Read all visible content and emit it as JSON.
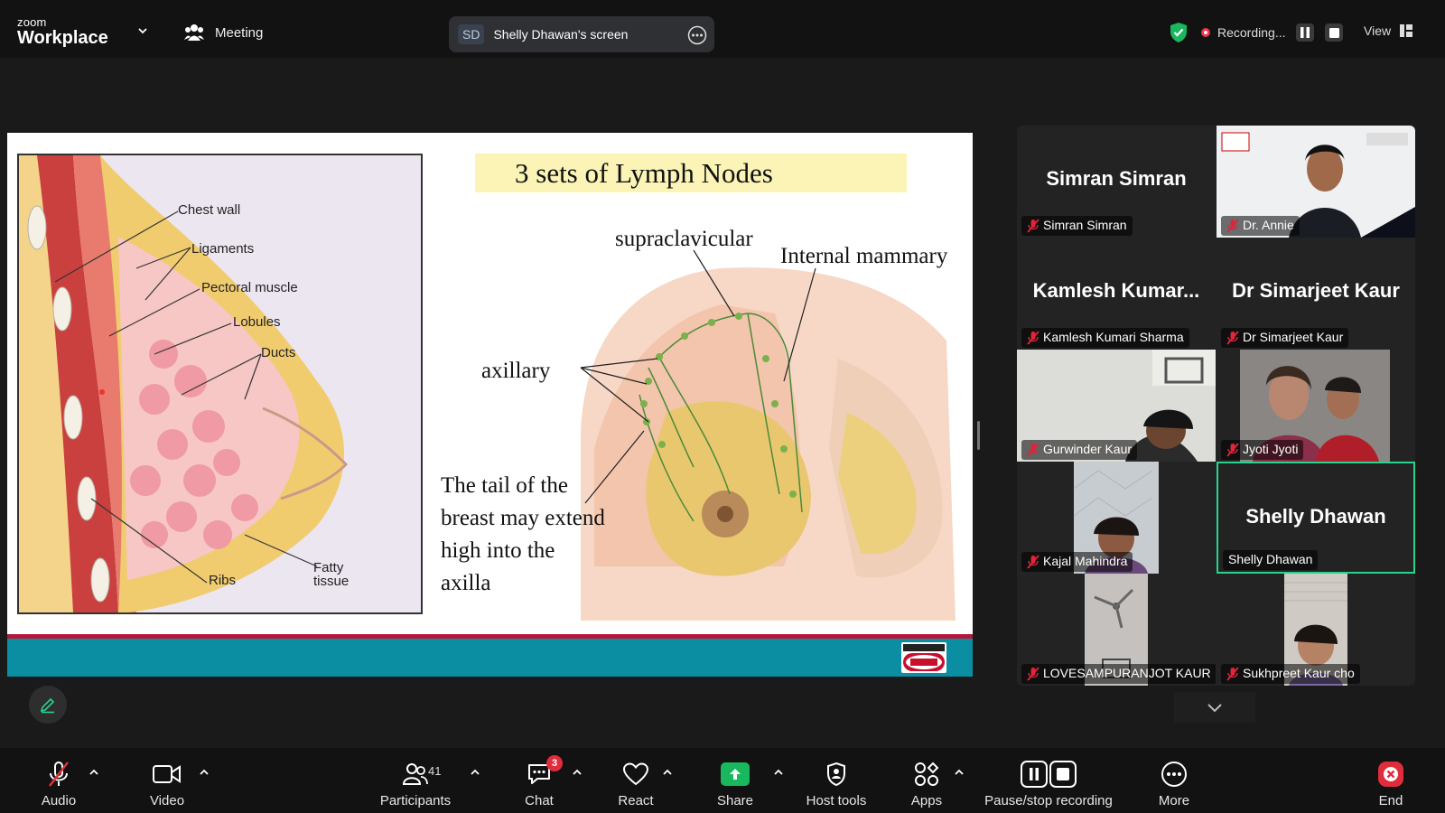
{
  "top_bar": {
    "brand_small": "zoom",
    "brand_large": "Workplace",
    "meeting_label": "Meeting",
    "screen_share": {
      "initials": "SD",
      "label": "Shelly Dhawan's screen"
    },
    "recording_label": "Recording...",
    "view_label": "View"
  },
  "slide": {
    "title": "3 sets of Lymph Nodes",
    "left_diagram_labels": [
      "Chest wall",
      "Ligaments",
      "Pectoral muscle",
      "Lobules",
      "Ducts",
      "Fatty",
      "tissue",
      "Ribs"
    ],
    "right_diagram_labels": {
      "supraclavicular": "supraclavicular",
      "internal": "Internal mammary",
      "axillary": "axillary",
      "tail_lines": [
        "The tail of the",
        "breast may extend",
        "high into the",
        "axilla"
      ]
    }
  },
  "participants": [
    {
      "big_name": "Simran Simran",
      "name": "Simran Simran",
      "muted": true,
      "video": false
    },
    {
      "big_name": "",
      "name": "Dr. Annie",
      "muted": true,
      "video": true
    },
    {
      "big_name": "Kamlesh Kumar...",
      "name": "Kamlesh Kumari Sharma",
      "muted": true,
      "video": false
    },
    {
      "big_name": "Dr Simarjeet Kaur",
      "name": "Dr Simarjeet Kaur",
      "muted": true,
      "video": false
    },
    {
      "big_name": "",
      "name": "Gurwinder Kaur",
      "muted": true,
      "video": true
    },
    {
      "big_name": "",
      "name": "Jyoti Jyoti",
      "muted": true,
      "video": true
    },
    {
      "big_name": "",
      "name": "Kajal Mahindra",
      "muted": true,
      "video": true
    },
    {
      "big_name": "Shelly Dhawan",
      "name": "Shelly Dhawan",
      "muted": false,
      "video": false,
      "active_speaker": true
    },
    {
      "big_name": "",
      "name": "LOVESAMPURANJOT KAUR",
      "muted": true,
      "video": true
    },
    {
      "big_name": "",
      "name": "Sukhpreet Kaur cho",
      "muted": true,
      "video": true
    }
  ],
  "toolbar": {
    "audio": "Audio",
    "video": "Video",
    "participants": "Participants",
    "participants_count": "41",
    "chat": "Chat",
    "chat_badge": "3",
    "react": "React",
    "share": "Share",
    "host_tools": "Host tools",
    "apps": "Apps",
    "pause_stop": "Pause/stop recording",
    "more": "More",
    "end": "End"
  },
  "colors": {
    "active_speaker_border": "#2ad38d",
    "share_green": "#19b85e",
    "recording_red": "#e8384f",
    "slide_teal": "#0b8ea2",
    "slide_accent": "#b5173a",
    "end_red": "#e02d3c",
    "muted_red": "#e0243a"
  }
}
